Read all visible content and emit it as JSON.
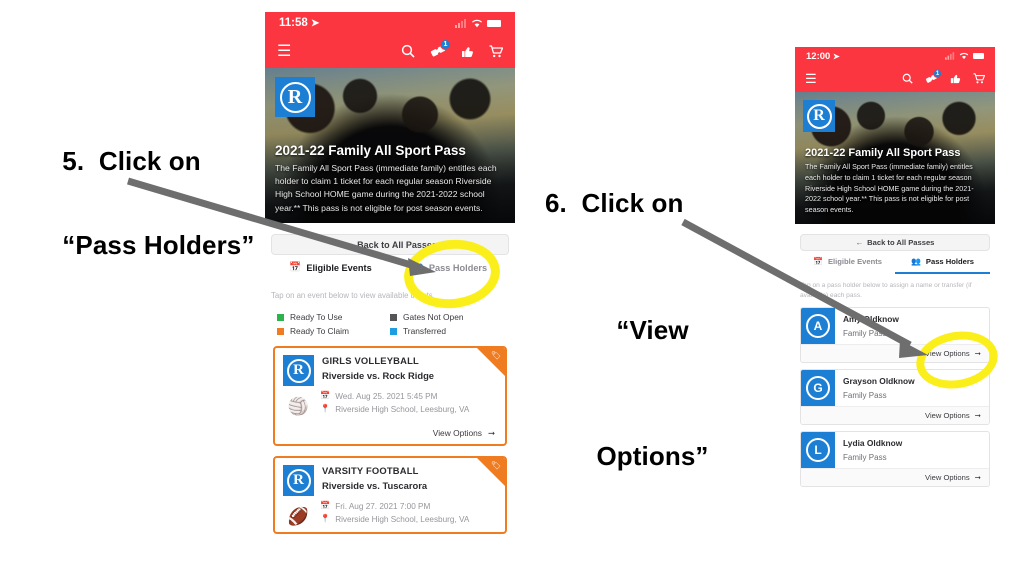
{
  "steps": {
    "five": {
      "line1": "5.  Click on",
      "line2": "“Pass Holders”"
    },
    "six": {
      "line1": "6.  Click on",
      "line2": "“View",
      "line3": "Options”"
    }
  },
  "phone_left": {
    "status": {
      "time": "11:58",
      "location_arrow": "➤",
      "wifi": "wifi-icon",
      "battery": "battery-icon"
    },
    "nav": {
      "menu": "☰",
      "search": "search-icon",
      "ticket": "ticket-icon",
      "ticket_badge": "1",
      "thumbs": "thumbs-up-icon",
      "cart": "cart-icon"
    },
    "hero": {
      "logo_letter": "R",
      "title": "2021-22 Family All Sport Pass",
      "description": "The Family All Sport Pass (immediate family) entitles each holder to claim 1 ticket for each regular season Riverside High School HOME game during the 2021-2022 school year.** This pass is not eligible for post season events."
    },
    "back_label": "Back to All Passes",
    "tabs": [
      {
        "label": "Eligible Events",
        "icon": "calendar-icon",
        "active": true
      },
      {
        "label": "Pass Holders",
        "icon": "people-icon",
        "active": false
      }
    ],
    "hint": "Tap on an event below to view available tickets.",
    "legend": [
      {
        "label": "Ready To Use",
        "color": "#2eb24c"
      },
      {
        "label": "Gates Not Open",
        "color": "#555558"
      },
      {
        "label": "Ready To Claim",
        "color": "#f07c22"
      },
      {
        "label": "Transferred",
        "color": "#1d9ee0"
      }
    ],
    "events": [
      {
        "sport": "GIRLS VOLLEYBALL",
        "matchup": "Riverside vs. Rock Ridge",
        "date": "Wed. Aug 25. 2021 5:45 PM",
        "venue": "Riverside High School, Leesburg, VA",
        "logo_letter": "R",
        "ball": "🏐",
        "action": "View Options"
      },
      {
        "sport": "VARSITY FOOTBALL",
        "matchup": "Riverside vs. Tuscarora",
        "date": "Fri. Aug 27. 2021 7:00 PM",
        "venue": "Riverside High School, Leesburg, VA",
        "logo_letter": "R",
        "ball": "🏈",
        "action": "View Options"
      }
    ]
  },
  "phone_right": {
    "status": {
      "time": "12:00",
      "location_arrow": "➤",
      "wifi": "wifi-icon",
      "battery": "battery-icon"
    },
    "nav": {
      "menu": "☰",
      "search": "search-icon",
      "ticket": "ticket-icon",
      "ticket_badge": "1",
      "thumbs": "thumbs-up-icon",
      "cart": "cart-icon"
    },
    "hero": {
      "logo_letter": "R",
      "title": "2021-22 Family All Sport Pass",
      "description": "The Family All Sport Pass (immediate family) entitles each holder to claim 1 ticket for each regular season Riverside High School HOME game during the 2021-2022 school year.** This pass is not eligible for post season events."
    },
    "back_label": "Back to All Passes",
    "tabs": [
      {
        "label": "Eligible Events",
        "icon": "calendar-icon",
        "active": false
      },
      {
        "label": "Pass Holders",
        "icon": "people-icon",
        "active": true
      }
    ],
    "hint": "Tap on a pass holder below to assign a name or transfer (if available) each pass.",
    "holders": [
      {
        "initial": "A",
        "name": "Amy Oldknow",
        "pass_type": "Family Pass",
        "action": "View Options"
      },
      {
        "initial": "G",
        "name": "Grayson Oldknow",
        "pass_type": "Family Pass",
        "action": "View Options"
      },
      {
        "initial": "L",
        "name": "Lydia Oldknow",
        "pass_type": "Family Pass",
        "action": "View Options"
      }
    ]
  },
  "annotations": {
    "highlight_color": "#fbef1b",
    "arrow_color": "#6e6e6e",
    "arrow_one_target": "Pass Holders tab",
    "arrow_two_target": "View Options button"
  }
}
